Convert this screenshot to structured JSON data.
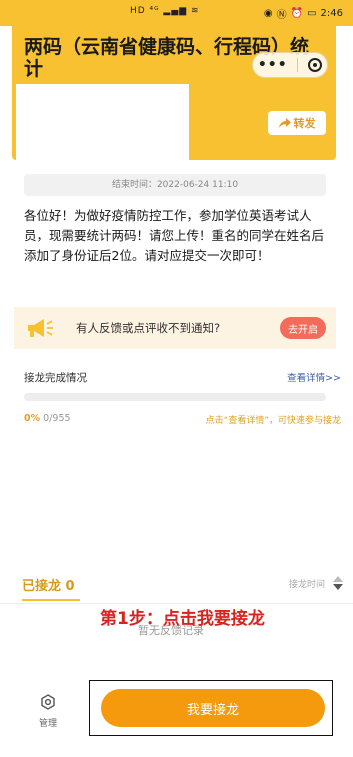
{
  "status_bar": {
    "time": "2:46"
  },
  "header": {
    "title": "两码（云南省健康码、行程码）统计",
    "share_label": "转发"
  },
  "end_time": {
    "text": "结束时间：2022-06-24 11:10"
  },
  "notice": {
    "text": "各位好！为做好疫情防控工作，参加学位英语考试人员，现需要统计两码！请您上传！重名的同学在姓名后添加了身份证后2位。请对应提交一次即可！"
  },
  "notify": {
    "text": "有人反馈或点评收不到通知?",
    "button": "去开启"
  },
  "progress": {
    "label": "接龙完成情况",
    "detail_link": "查看详情>>",
    "percent": "0%",
    "count": "0/955",
    "fill_fraction": 0,
    "hint": "点击“查看详情”，可快速参与接龙"
  },
  "tabs": {
    "joined": "已接龙 0",
    "sort_label": "接龙时间"
  },
  "list": {
    "empty_text": "暂无反馈记录"
  },
  "annotation": {
    "text": "第1步：点击我要接龙"
  },
  "bottom": {
    "manage_label": "管理",
    "join_button": "我要接龙"
  },
  "colors": {
    "brand_yellow": "#f7c132",
    "join_orange": "#f59a0c",
    "annotation_red": "#d9231f",
    "notify_button": "#f26b5b"
  },
  "icons": {
    "share": "share-arrow-icon",
    "notify": "megaphone-icon",
    "manage": "hexagon-gear-icon",
    "capsule_menu": "more-dots-icon",
    "capsule_close": "target-close-icon"
  }
}
